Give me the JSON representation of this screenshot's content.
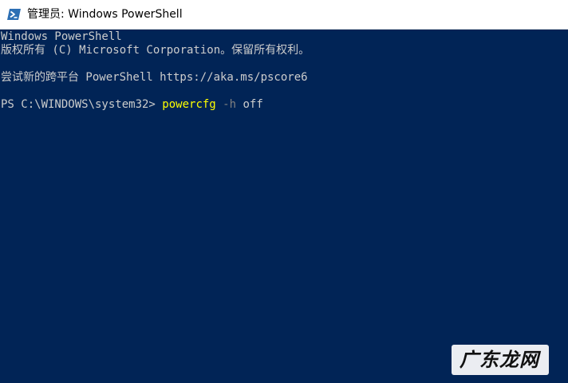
{
  "window": {
    "title": "管理员: Windows PowerShell",
    "icon": "powershell-icon"
  },
  "console": {
    "lines": [
      "Windows PowerShell",
      "版权所有 (C) Microsoft Corporation。保留所有权利。",
      "尝试新的跨平台 PowerShell https://aka.ms/pscore6"
    ],
    "prompt": "PS C:\\WINDOWS\\system32> ",
    "command": "powercfg",
    "parameter": "-h",
    "argument": "off"
  },
  "watermark": {
    "text": "广东龙网"
  },
  "colors": {
    "console_background": "#012456",
    "console_text": "#cccccc",
    "command": "#ffff00",
    "parameter": "#808080"
  }
}
